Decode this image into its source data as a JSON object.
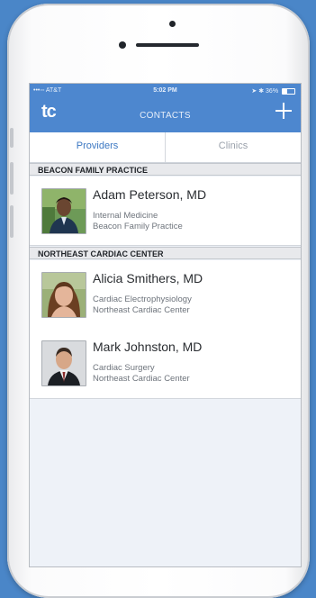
{
  "status_bar": {
    "carrier": "•••◦◦ AT&T",
    "time": "5:02 PM",
    "battery": "36%"
  },
  "nav": {
    "logo": "tc",
    "title": "CONTACTS"
  },
  "tabs": [
    {
      "label": "Providers",
      "active": true
    },
    {
      "label": "Clinics",
      "active": false
    }
  ],
  "sections": [
    {
      "title": "BEACON FAMILY PRACTICE",
      "contacts": [
        {
          "name": "Adam Peterson, MD",
          "specialty": "Internal Medicine",
          "practice": "Beacon Family Practice"
        }
      ]
    },
    {
      "title": "NORTHEAST CARDIAC CENTER",
      "contacts": [
        {
          "name": "Alicia Smithers, MD",
          "specialty": "Cardiac Electrophysiology",
          "practice": "Northeast Cardiac Center"
        },
        {
          "name": "Mark Johnston, MD",
          "specialty": "Cardiac Surgery",
          "practice": "Northeast Cardiac Center"
        }
      ]
    }
  ],
  "colors": {
    "background": "#4a86c8",
    "nav_bar": "#4d87cf",
    "active_tab": "#3b77c2",
    "inactive_tab": "#9aa1ab"
  }
}
